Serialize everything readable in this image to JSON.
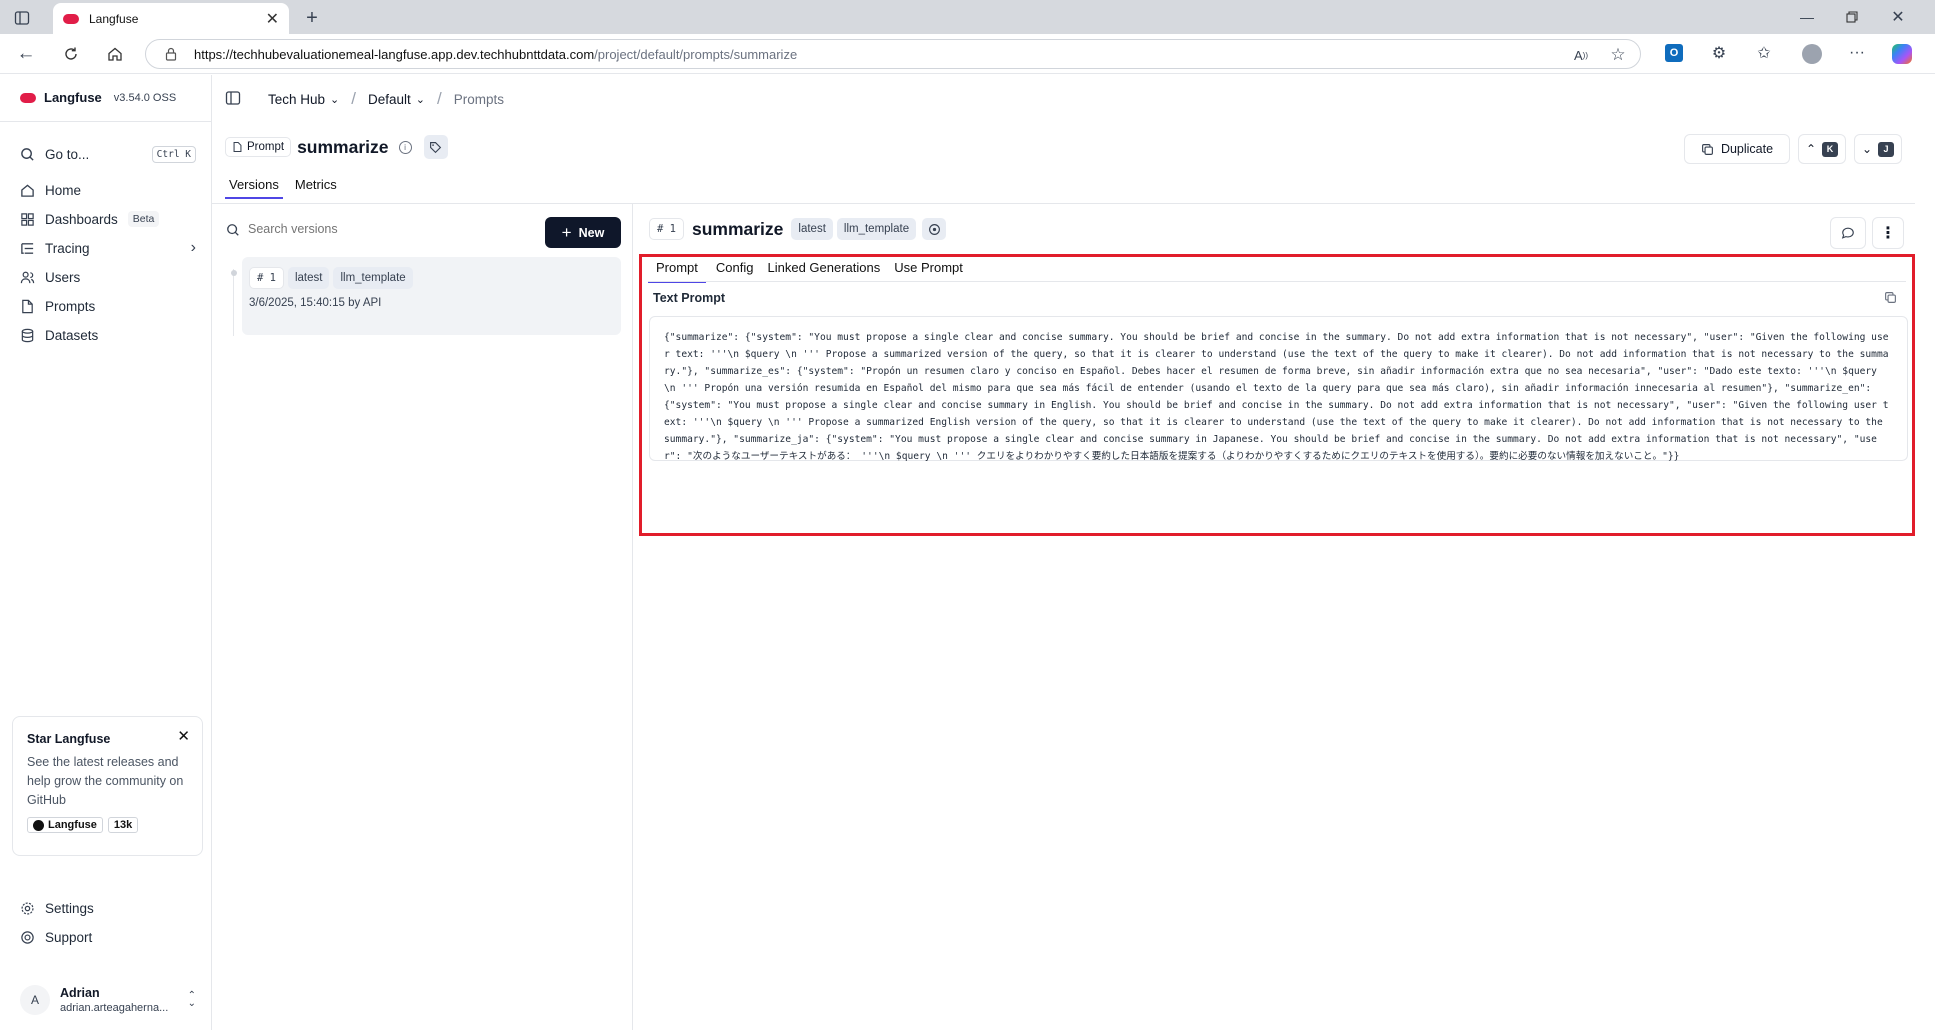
{
  "browser": {
    "tab_title": "Langfuse",
    "url_host": "https://techhubevaluationemeal-langfuse.app.dev.techhubnttdata.com",
    "url_path": "/project/default/prompts/summarize"
  },
  "app": {
    "name": "Langfuse",
    "version": "v3.54.0 OSS"
  },
  "sidebar": {
    "goto_label": "Go to...",
    "goto_shortcut": "Ctrl K",
    "items": [
      {
        "label": "Home",
        "icon": "home-icon"
      },
      {
        "label": "Dashboards",
        "icon": "dashboard-icon",
        "badge": "Beta"
      },
      {
        "label": "Tracing",
        "icon": "tracing-icon"
      },
      {
        "label": "Users",
        "icon": "users-icon"
      },
      {
        "label": "Prompts",
        "icon": "file-icon"
      },
      {
        "label": "Datasets",
        "icon": "database-icon"
      }
    ],
    "star_card": {
      "title": "Star Langfuse",
      "text": "See the latest releases and help grow the community on GitHub",
      "github_label": "Langfuse",
      "github_count": "13k"
    },
    "settings_label": "Settings",
    "support_label": "Support",
    "user": {
      "initial": "A",
      "name": "Adrian",
      "email": "adrian.arteagaherna..."
    }
  },
  "breadcrumb": {
    "org": "Tech Hub",
    "project": "Default",
    "page": "Prompts"
  },
  "header": {
    "type_badge": "Prompt",
    "title": "summarize",
    "duplicate_label": "Duplicate",
    "prev_key": "K",
    "next_key": "J",
    "tabs": [
      "Versions",
      "Metrics"
    ]
  },
  "versions": {
    "search_placeholder": "Search versions",
    "new_label": "New",
    "list": [
      {
        "number": "# 1",
        "labels": [
          "latest",
          "llm_template"
        ],
        "meta": "3/6/2025, 15:40:15 by API"
      }
    ]
  },
  "detail": {
    "version": "# 1",
    "name": "summarize",
    "labels": [
      "latest",
      "llm_template"
    ],
    "tabs": [
      "Prompt",
      "Config",
      "Linked Generations",
      "Use Prompt"
    ],
    "section_title": "Text Prompt",
    "prompt_text": "{\"summarize\": {\"system\": \"You must propose a single clear and concise summary. You should be brief and concise in the summary. Do not add extra information that is not necessary\", \"user\": \"Given the following user text: '''\\n $query \\n ''' Propose a summarized version of the query, so that it is clearer to understand (use the text of the query to make it clearer). Do not add information that is not necessary to the summary.\"}, \"summarize_es\": {\"system\": \"Propón un resumen claro y conciso en Español. Debes hacer el resumen de forma breve, sin añadir información extra que no sea necesaria\", \"user\": \"Dado este texto: '''\\n $query \\n ''' Propón una versión resumida en Español del mismo para que sea más fácil de entender (usando el texto de la query para que sea más claro), sin añadir información innecesaria al resumen\"}, \"summarize_en\": {\"system\": \"You must propose a single clear and concise summary in English. You should be brief and concise in the summary. Do not add extra information that is not necessary\", \"user\": \"Given the following user text: '''\\n $query \\n ''' Propose a summarized English version of the query, so that it is clearer to understand (use the text of the query to make it clearer). Do not add information that is not necessary to the summary.\"}, \"summarize_ja\": {\"system\": \"You must propose a single clear and concise summary in Japanese. You should be brief and concise in the summary. Do not add extra information that is not necessary\", \"user\": \"次のようなユーザーテキストがある： '''\\n $query \\n ''' クエリをよりわかりやすく要約した日本語版を提案する（よりわかりやすくするためにクエリのテキストを使用する）。要約に必要のない情報を加えないこと。\"}}"
  },
  "colors": {
    "accent": "#4f46e5",
    "highlight": "#e11d2a",
    "primary_button": "#0f172a",
    "badge_bg": "#e8ecf3"
  }
}
